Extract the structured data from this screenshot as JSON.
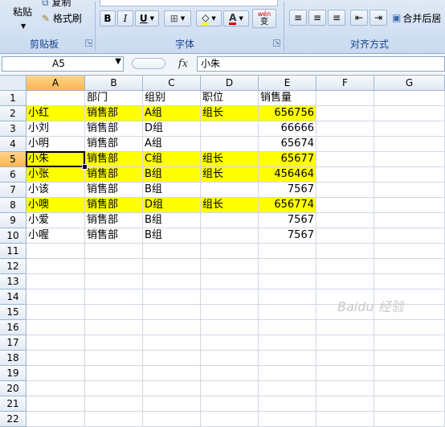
{
  "ribbon": {
    "clipboard": {
      "paste": "粘贴",
      "copy": "复制",
      "format_painter": "格式刷",
      "label": "剪贴板"
    },
    "font": {
      "bold": "B",
      "italic": "I",
      "underline": "U",
      "font_color": "A",
      "phonetic": "wén",
      "phonetic_sub": "变",
      "label": "字体"
    },
    "alignment": {
      "merge_center": "合并后居",
      "label": "对齐方式"
    }
  },
  "formula_bar": {
    "name_box": "A5",
    "fx": "fx",
    "content": "小朱"
  },
  "columns": [
    "A",
    "B",
    "C",
    "D",
    "E",
    "F",
    "G"
  ],
  "rows": [
    {
      "n": "1",
      "a": "",
      "b": "部门",
      "c": "组别",
      "d": "职位",
      "e": "销售量",
      "hl": false
    },
    {
      "n": "2",
      "a": "小红",
      "b": "销售部",
      "c": "A组",
      "d": "组长",
      "e": "656756",
      "hl": true
    },
    {
      "n": "3",
      "a": "小刘",
      "b": "销售部",
      "c": "D组",
      "d": "",
      "e": "66666",
      "hl": false
    },
    {
      "n": "4",
      "a": "小明",
      "b": "销售部",
      "c": "A组",
      "d": "",
      "e": "65674",
      "hl": false
    },
    {
      "n": "5",
      "a": "小朱",
      "b": "销售部",
      "c": "C组",
      "d": "组长",
      "e": "65677",
      "hl": true
    },
    {
      "n": "6",
      "a": "小张",
      "b": "销售部",
      "c": "B组",
      "d": "组长",
      "e": "456464",
      "hl": true
    },
    {
      "n": "7",
      "a": "小该",
      "b": "销售部",
      "c": "B组",
      "d": "",
      "e": "7567",
      "hl": false
    },
    {
      "n": "8",
      "a": "小噢",
      "b": "销售部",
      "c": "D组",
      "d": "组长",
      "e": "656774",
      "hl": true
    },
    {
      "n": "9",
      "a": "小爱",
      "b": "销售部",
      "c": "B组",
      "d": "",
      "e": "7567",
      "hl": false
    },
    {
      "n": "10",
      "a": "小喔",
      "b": "销售部",
      "c": "B组",
      "d": "",
      "e": "7567",
      "hl": false
    },
    {
      "n": "11"
    },
    {
      "n": "12"
    },
    {
      "n": "13"
    },
    {
      "n": "14"
    },
    {
      "n": "15"
    },
    {
      "n": "16"
    },
    {
      "n": "17"
    },
    {
      "n": "18"
    },
    {
      "n": "19"
    },
    {
      "n": "20"
    },
    {
      "n": "21"
    },
    {
      "n": "22"
    }
  ],
  "active_cell": "A5",
  "colors": {
    "highlight": "#ffff00",
    "header_selected": "#f9b54f",
    "ribbon_label": "#15428b"
  },
  "watermark": "Baidu 经验"
}
